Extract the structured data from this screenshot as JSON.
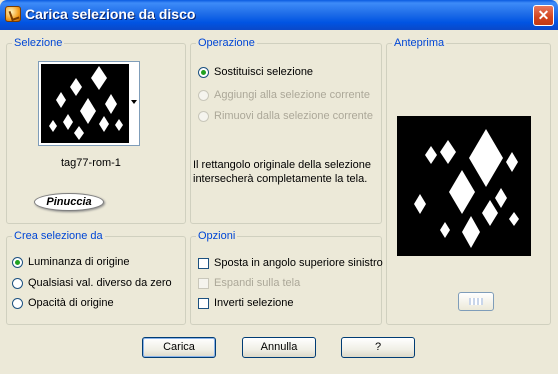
{
  "window": {
    "title": "Carica selezione da disco",
    "close_glyph": "✕"
  },
  "selezione": {
    "title": "Selezione",
    "file_name": "tag77-rom-1",
    "logo_text": "Pinuccia"
  },
  "operazione": {
    "title": "Operazione",
    "options": [
      {
        "label": "Sostituisci selezione",
        "checked": true,
        "enabled": true
      },
      {
        "label": "Aggiungi alla selezione corrente",
        "checked": false,
        "enabled": false
      },
      {
        "label": "Rimuovi dalla selezione corrente",
        "checked": false,
        "enabled": false
      }
    ],
    "info": "Il rettangolo originale della selezione intersecherà completamente la tela."
  },
  "anteprima": {
    "title": "Anteprima"
  },
  "crea": {
    "title": "Crea selezione da",
    "options": [
      {
        "label": "Luminanza di origine",
        "checked": true
      },
      {
        "label": "Qualsiasi val. diverso da zero",
        "checked": false
      },
      {
        "label": "Opacità di origine",
        "checked": false
      }
    ]
  },
  "opzioni": {
    "title": "Opzioni",
    "options": [
      {
        "label": "Sposta in angolo superiore sinistro",
        "checked": false,
        "enabled": true
      },
      {
        "label": "Espandi sulla tela",
        "checked": false,
        "enabled": false
      },
      {
        "label": "Inverti selezione",
        "checked": false,
        "enabled": true
      }
    ]
  },
  "buttons": {
    "load": "Carica",
    "cancel": "Annulla",
    "help": "?"
  }
}
